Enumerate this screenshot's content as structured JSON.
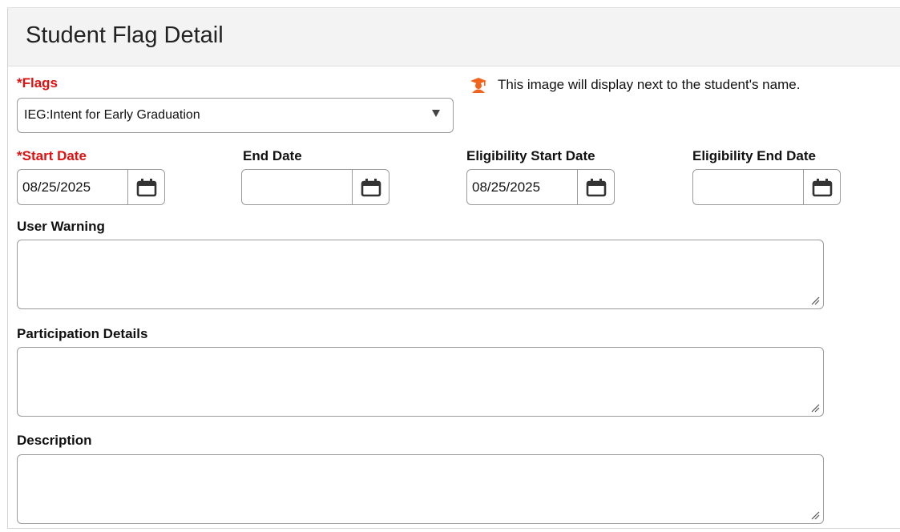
{
  "page": {
    "title": "Student Flag Detail"
  },
  "flags": {
    "label": "*Flags",
    "selected": "IEG:Intent for Early Graduation",
    "hint": "This image will display next to the student's name.",
    "hint_icon": "graduate-icon",
    "hint_icon_color": "#f0641e"
  },
  "dates": {
    "start": {
      "label": "*Start Date",
      "value": "08/25/2025"
    },
    "end": {
      "label": "End Date",
      "value": ""
    },
    "elig_start": {
      "label": "Eligibility Start Date",
      "value": "08/25/2025"
    },
    "elig_end": {
      "label": "Eligibility End Date",
      "value": ""
    }
  },
  "user_warning": {
    "label": "User Warning",
    "value": ""
  },
  "participation": {
    "label": "Participation Details",
    "value": ""
  },
  "description": {
    "label": "Description",
    "value": ""
  },
  "colors": {
    "required": "#e01010",
    "border": "#9a9a9a",
    "header_bg": "#f3f3f3"
  }
}
